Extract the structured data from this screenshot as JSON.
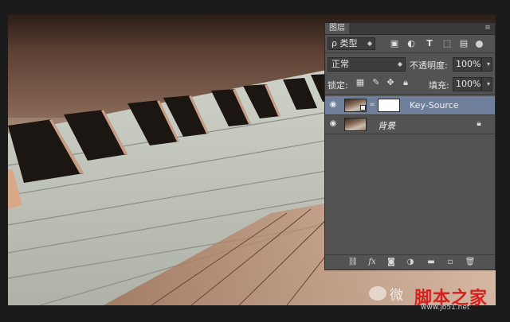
{
  "panel": {
    "title": "图层",
    "menu_icon": "panel-menu-icon",
    "filter": {
      "label": "ρ 类型",
      "icons": [
        "image-filter-icon",
        "adjustment-filter-icon",
        "type-filter-icon",
        "shape-filter-icon",
        "smart-object-filter-icon"
      ]
    },
    "blend_mode": "正常",
    "opacity_label": "不透明度:",
    "opacity_value": "100%",
    "lock_label": "锁定:",
    "fill_label": "填充:",
    "fill_value": "100%",
    "layers": [
      {
        "name": "Key-Source",
        "selected": true,
        "visible": true,
        "has_mask": true
      },
      {
        "name": "背景",
        "selected": false,
        "visible": true,
        "locked": true
      }
    ],
    "bottom_icons": [
      "link-layers-icon",
      "fx-icon",
      "add-mask-icon",
      "adjustment-layer-icon",
      "new-group-icon",
      "new-layer-icon",
      "trash-icon"
    ]
  },
  "watermark": {
    "text": "微",
    "brand": "脚本之家",
    "url": "www.jb51.net"
  }
}
